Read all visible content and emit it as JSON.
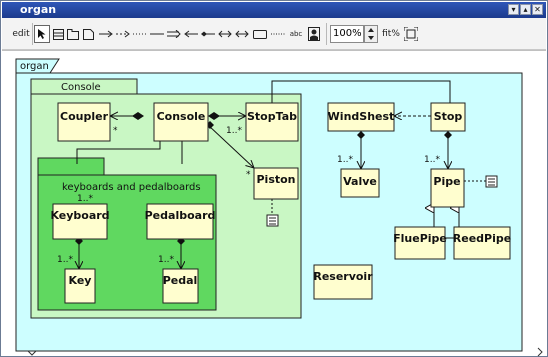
{
  "window": {
    "title": "organ"
  },
  "toolbar": {
    "edit_label": "edit",
    "zoom_value": "100%",
    "fit_label": "fit%",
    "text_tool_label": "abc"
  },
  "diagram": {
    "package_organ": "organ",
    "package_console": "Console",
    "package_keyboards": "keyboards and pedalboards",
    "classes": {
      "coupler": "Coupler",
      "console": "Console",
      "stoptab": "StopTab",
      "windshest": "WindShest",
      "stop": "Stop",
      "piston": "Piston",
      "valve": "Valve",
      "pipe": "Pipe",
      "keyboard": "Keyboard",
      "pedalboard": "Pedalboard",
      "key": "Key",
      "pedal": "Pedal",
      "flutepipe": "FluePipe",
      "reedpipe": "ReedPipe",
      "reservoir": "Reservoir"
    },
    "multiplicities": {
      "coupler_star": "*",
      "stoptab_mult": "1..*",
      "piston_star": "*",
      "keyboard_mult": "1..*",
      "key_mult": "1..*",
      "pedal_mult": "1..*",
      "valve_mult": "1..*",
      "pipe_mult": "1..*"
    }
  },
  "colors": {
    "organ_package": "#cdfeff",
    "console_package": "#c9f7c4",
    "keyboards_package": "#60d860",
    "class_fill": "#fffecf",
    "titlebar": "#1f43a0"
  }
}
